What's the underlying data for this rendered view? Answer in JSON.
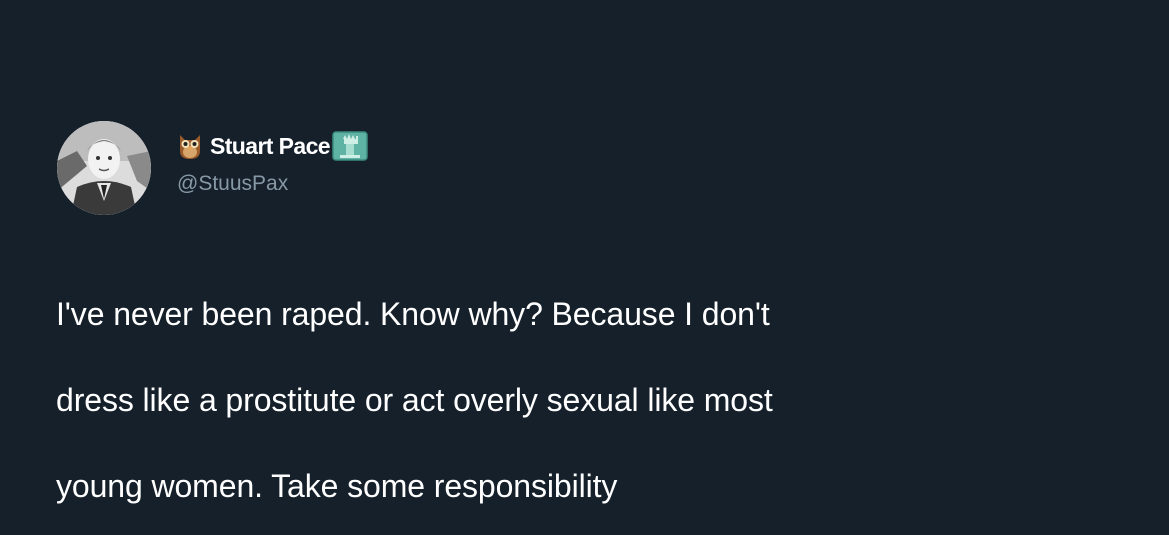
{
  "tweet": {
    "author": {
      "display_name": "Stuart Pace",
      "handle": "@StuusPax",
      "name_prefix_icon": "owl-emoji-icon",
      "name_suffix_icon": "statue-of-liberty-emoji-icon",
      "avatar": "grayscale-profile-photo"
    },
    "text_lines": [
      "I've never been raped. Know why? Because I don't",
      "dress like a prostitute or act overly sexual like most",
      "young women. Take some responsibility"
    ]
  },
  "colors": {
    "background": "#15202b",
    "primary_text": "#ffffff",
    "secondary_text": "#8899a6",
    "statue_green": "#5fb3a4"
  }
}
